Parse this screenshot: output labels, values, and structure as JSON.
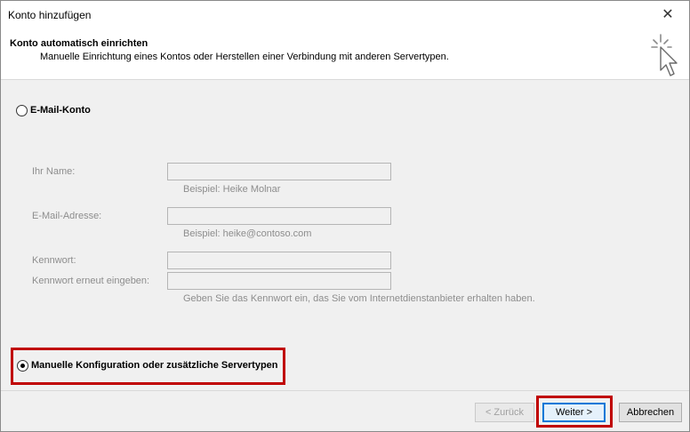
{
  "window": {
    "title": "Konto hinzufügen",
    "close_label": "✕"
  },
  "header": {
    "title": "Konto automatisch einrichten",
    "subtitle": "Manuelle Einrichtung eines Kontos oder Herstellen einer Verbindung mit anderen Servertypen."
  },
  "options": {
    "email_account": {
      "label": "E-Mail-Konto",
      "selected": false
    },
    "manual_config": {
      "label": "Manuelle Konfiguration oder zusätzliche Servertypen",
      "selected": true
    }
  },
  "fields": {
    "name": {
      "label": "Ihr Name:",
      "value": "",
      "hint": "Beispiel: Heike Molnar"
    },
    "email": {
      "label": "E-Mail-Adresse:",
      "value": "",
      "hint": "Beispiel: heike@contoso.com"
    },
    "password": {
      "label": "Kennwort:",
      "value": ""
    },
    "password_confirm": {
      "label": "Kennwort erneut eingeben:",
      "value": "",
      "hint": "Geben Sie das Kennwort ein, das Sie vom Internetdienstanbieter erhalten haben."
    }
  },
  "buttons": {
    "back": "< Zurück",
    "next": "Weiter >",
    "cancel": "Abbrechen"
  },
  "colors": {
    "highlight": "#c00000",
    "default_button_border": "#0078d7"
  }
}
